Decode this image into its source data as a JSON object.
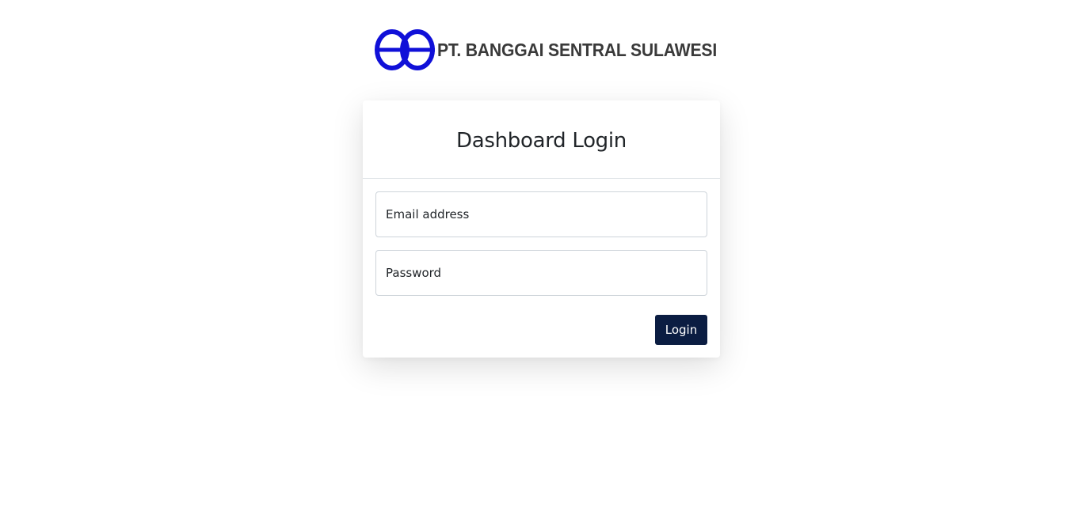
{
  "brand": {
    "company_name": "PT. BANGGAI SENTRAL SULAWESI",
    "logo_icon": "company-logo-mark",
    "logo_color": "#1010d8"
  },
  "login_card": {
    "title": "Dashboard Login",
    "email": {
      "placeholder": "Email address",
      "value": ""
    },
    "password": {
      "placeholder": "Password",
      "value": ""
    },
    "submit_label": "Login",
    "submit_color": "#0b1d42"
  }
}
